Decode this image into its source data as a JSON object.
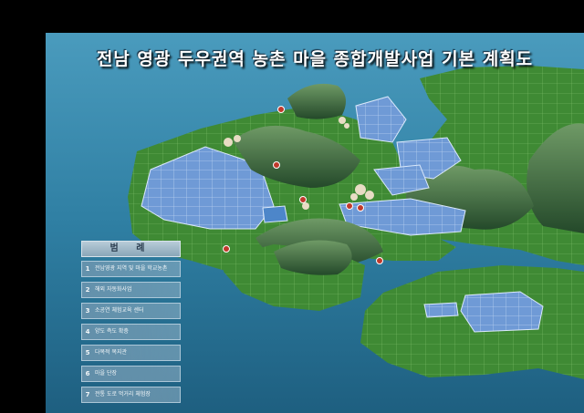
{
  "title": "전남 영광 두우권역 농촌 마을 종합개발사업 기본 계획도",
  "legend": {
    "header": "범 례",
    "items": [
      {
        "num": "1",
        "label": "전남영광 지역 및 마을 학교농촌"
      },
      {
        "num": "2",
        "label": "해외 자동화사업"
      },
      {
        "num": "3",
        "label": "소공연 체험교육 센터"
      },
      {
        "num": "4",
        "label": "양도 측도 확충"
      },
      {
        "num": "5",
        "label": "다목적 복지관"
      },
      {
        "num": "6",
        "label": "마을 단장"
      },
      {
        "num": "7",
        "label": "전통 도로 먹거리 체험장"
      }
    ]
  },
  "colors": {
    "sea": "#2f7fa3",
    "land": "#3f8a34",
    "field_blue": "#6f9ad6",
    "hill": "#2c5a2e",
    "marker": "#c0392b"
  }
}
